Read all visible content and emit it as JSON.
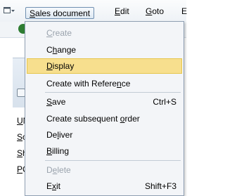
{
  "menubar": {
    "items": [
      {
        "label": "Sales document",
        "mnemonic": "S",
        "rest": "ales document"
      },
      {
        "label": "Edit",
        "mnemonic": "E",
        "rest": "dit"
      },
      {
        "label": "Goto",
        "mnemonic": "G",
        "rest": "oto"
      },
      {
        "label": "E"
      }
    ]
  },
  "background": {
    "labels": [
      {
        "pre": "",
        "ul": "U",
        "post": "N"
      },
      {
        "pre": "",
        "ul": "S",
        "post": "o"
      },
      {
        "pre": "",
        "ul": "S",
        "post": "h"
      },
      {
        "pre": "",
        "ul": "P",
        "post": "O"
      }
    ]
  },
  "dropdown": {
    "items": [
      {
        "pre": "",
        "ul": "C",
        "post": "reate",
        "label": "Create",
        "shortcut": "",
        "disabled": true
      },
      {
        "pre": "C",
        "ul": "h",
        "post": "ange",
        "label": "Change",
        "shortcut": ""
      },
      {
        "pre": "",
        "ul": "D",
        "post": "isplay",
        "label": "Display",
        "shortcut": "",
        "highlighted": true
      },
      {
        "pre": "Create with Refere",
        "ul": "n",
        "post": "ce",
        "label": "Create with Reference",
        "shortcut": ""
      },
      {
        "pre": "",
        "ul": "S",
        "post": "ave",
        "label": "Save",
        "shortcut": "Ctrl+S"
      },
      {
        "pre": "Create subsequent ",
        "ul": "o",
        "post": "rder",
        "label": "Create subsequent order",
        "shortcut": ""
      },
      {
        "pre": "De",
        "ul": "l",
        "post": "iver",
        "label": "Deliver",
        "shortcut": ""
      },
      {
        "pre": "",
        "ul": "B",
        "post": "illing",
        "label": "Billing",
        "shortcut": ""
      },
      {
        "pre": "D",
        "ul": "e",
        "post": "lete",
        "label": "Delete",
        "shortcut": "",
        "disabled": true
      },
      {
        "pre": "E",
        "ul": "x",
        "post": "it",
        "label": "Exit",
        "shortcut": "Shift+F3"
      }
    ]
  },
  "colors": {
    "highlight": "#f7df8e",
    "highlight_border": "#e6c64d",
    "disabled_text": "#9aa3ad",
    "menu_background": "#f3f5f8",
    "status_green": "#2e7d32"
  }
}
